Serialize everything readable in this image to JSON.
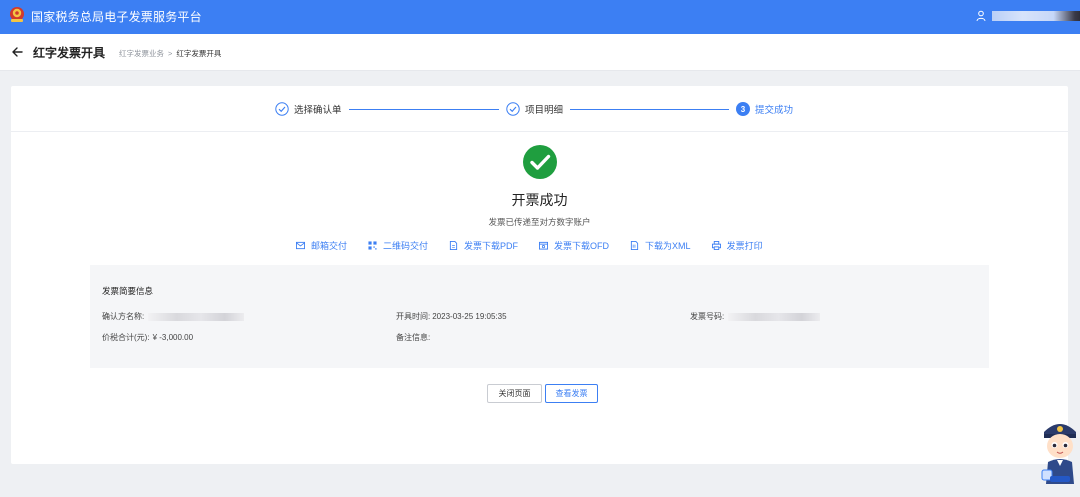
{
  "header": {
    "site_title": "国家税务总局电子发票服务平台",
    "user_icon": "user-icon",
    "logo_icon": "tax-emblem-icon",
    "brand_color": "#3c7ff3"
  },
  "subheader": {
    "title": "红字发票开具",
    "breadcrumb": [
      "红字发票业务",
      "红字发票开具"
    ],
    "separator": ">"
  },
  "steps": [
    {
      "label": "选择确认单",
      "state": "done"
    },
    {
      "label": "项目明细",
      "state": "done"
    },
    {
      "number": "3",
      "label": "提交成功",
      "state": "active"
    }
  ],
  "result": {
    "title": "开票成功",
    "subtitle": "发票已传递至对方数字账户",
    "status_color": "#1f9e3f"
  },
  "actions": [
    {
      "label": "邮箱交付",
      "icon": "mail-icon"
    },
    {
      "label": "二维码交付",
      "icon": "qrcode-icon"
    },
    {
      "label": "发票下载PDF",
      "icon": "pdf-icon"
    },
    {
      "label": "发票下载OFD",
      "icon": "ofd-icon"
    },
    {
      "label": "下载为XML",
      "icon": "xml-icon"
    },
    {
      "label": "发票打印",
      "icon": "printer-icon"
    }
  ],
  "summary": {
    "title": "发票简要信息",
    "buyer_label": "确认方名称:",
    "issue_time_label": "开具时间:",
    "issue_time": "2023-03-25 19:05:35",
    "invoice_no_label": "发票号码:",
    "total_label": "价税合计(元):",
    "total_value": "¥ -3,000.00",
    "remark_label": "备注信息:"
  },
  "buttons": {
    "close": "关闭页面",
    "view": "查看发票"
  }
}
